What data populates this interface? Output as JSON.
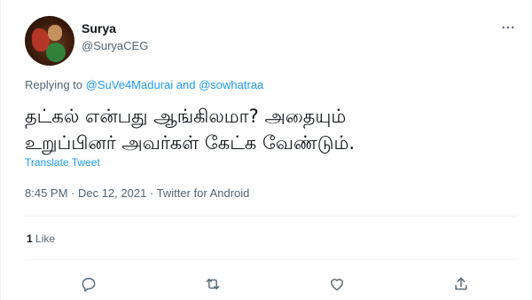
{
  "user": {
    "name": "Surya",
    "handle": "@SuryaCEG"
  },
  "replying": {
    "prefix": "Replying to",
    "mention1": "@SuVe4Madurai",
    "conjunction": "and",
    "mention2": "@sowhatraa"
  },
  "tweet": {
    "line1": "தட்கல் என்பது ஆங்கிலமா? அதையும்",
    "line2": "உறுப்பினர் அவர்கள் கேட்க வேண்டும்.",
    "translate_label": "Translate Tweet",
    "meta": "8:45 PM · Dec 12, 2021 · Twitter for Android"
  },
  "stats": {
    "like_count": "1",
    "like_label": "Like"
  },
  "icons": {
    "more": "more-dots-icon",
    "reply": "reply-icon",
    "retweet": "retweet-icon",
    "like": "heart-icon",
    "share": "share-icon"
  },
  "colors": {
    "accent": "#1d9bf0",
    "text": "#0f1419",
    "secondary": "#536471",
    "divider": "#eff3f4"
  }
}
